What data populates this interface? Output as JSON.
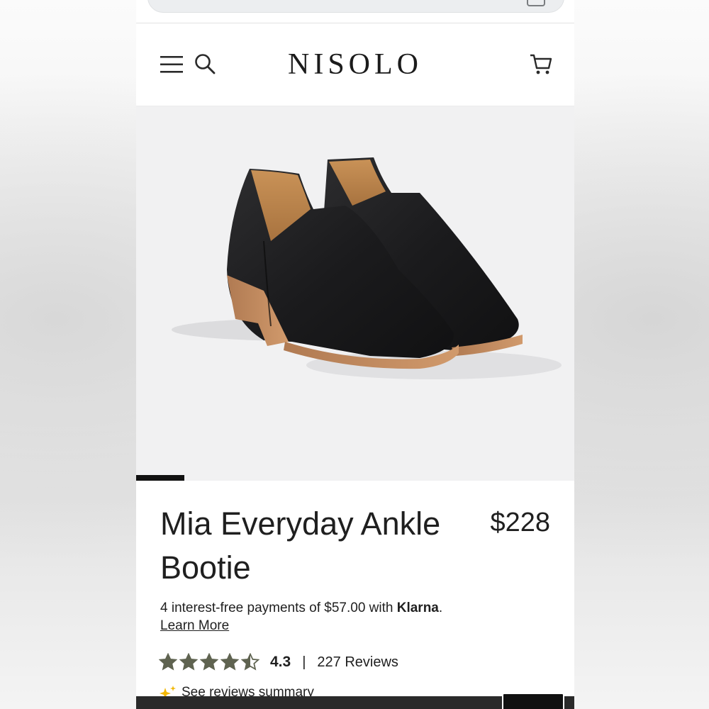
{
  "brand": {
    "logo": "NISOLO"
  },
  "header": {
    "menu_icon": "hamburger-menu-icon",
    "search_icon": "search-icon",
    "cart_icon": "shopping-cart-icon"
  },
  "gallery": {
    "image_alt": "black leather ankle booties with wooden heel",
    "slide_progress": 0.11
  },
  "product": {
    "title": "Mia Everyday Ankle Bootie",
    "price": "$228"
  },
  "payments": {
    "text_before": "4 interest-free payments of $57.00 with ",
    "provider": "Klarna",
    "text_after": ".",
    "learn_more": "Learn More"
  },
  "rating": {
    "value": "4.3",
    "separator": "|",
    "reviews_label": "227 Reviews",
    "stars": 4.5,
    "star_color": "#5f6350"
  },
  "reviews_summary": {
    "label": "See reviews summary"
  },
  "colors": {
    "text": "#1f1f1f",
    "accent": "#111111",
    "hero_bg": "#f1f1f2"
  }
}
